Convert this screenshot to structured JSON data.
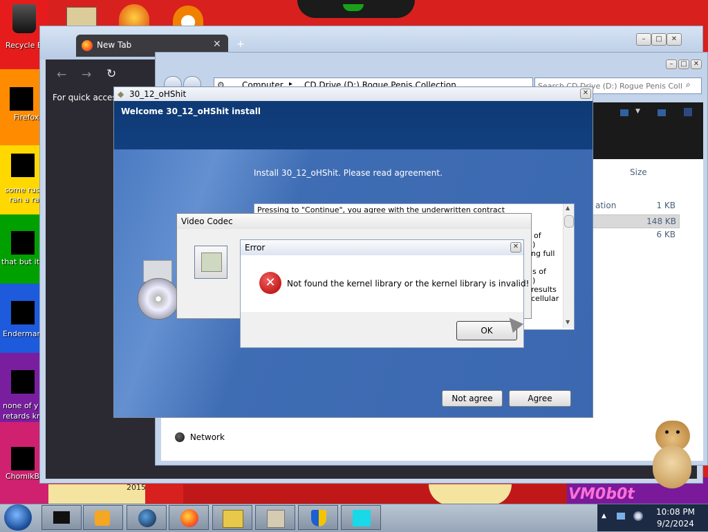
{
  "desktop": {
    "icons": [
      {
        "label": "Recycle B"
      },
      {
        "label": "Firefox"
      },
      {
        "label": "some russ ran a ra"
      },
      {
        "label": "that but its"
      },
      {
        "label": "Enderman"
      },
      {
        "label": "none of y retards kn"
      },
      {
        "label": "ChomikB"
      }
    ],
    "year_text": "2015",
    "vm_text": "VM0b0t"
  },
  "browser": {
    "tab_title": "New Tab",
    "quick_access_text": "For quick access,"
  },
  "explorer": {
    "breadcrumb": [
      "Computer",
      "CD Drive (D:) Rogue Penis Collection"
    ],
    "search_placeholder": "Search CD Drive (D:) Rogue Penis Coll...",
    "column_size": "Size",
    "rows": [
      {
        "type_partial": "ation",
        "size": "1 KB"
      },
      {
        "type_partial": "",
        "size": "148 KB"
      },
      {
        "type_partial": "",
        "size": "6 KB"
      }
    ],
    "network_label": "Network"
  },
  "installer": {
    "title": "30_12_oHShit",
    "header": "Welcome 30_12_oHShit install",
    "instruction": "Install 30_12_oHShit. Please read agreement.",
    "agreement_first_line": "Pressing to \"Continue\", you agree with the underwritten contract",
    "agreement_fragments": [
      "of",
      ")",
      "ng full",
      "s of",
      ")",
      "results",
      "cellular"
    ],
    "not_agree_label": "Not agree",
    "agree_label": "Agree"
  },
  "video_codec": {
    "title": "Video Codec"
  },
  "error_dialog": {
    "title": "Error",
    "message": "Not found the kernel library or the kernel library is invalid!",
    "ok_label": "OK"
  },
  "taskbar": {
    "time": "10:08 PM",
    "date": "9/2/2024"
  }
}
